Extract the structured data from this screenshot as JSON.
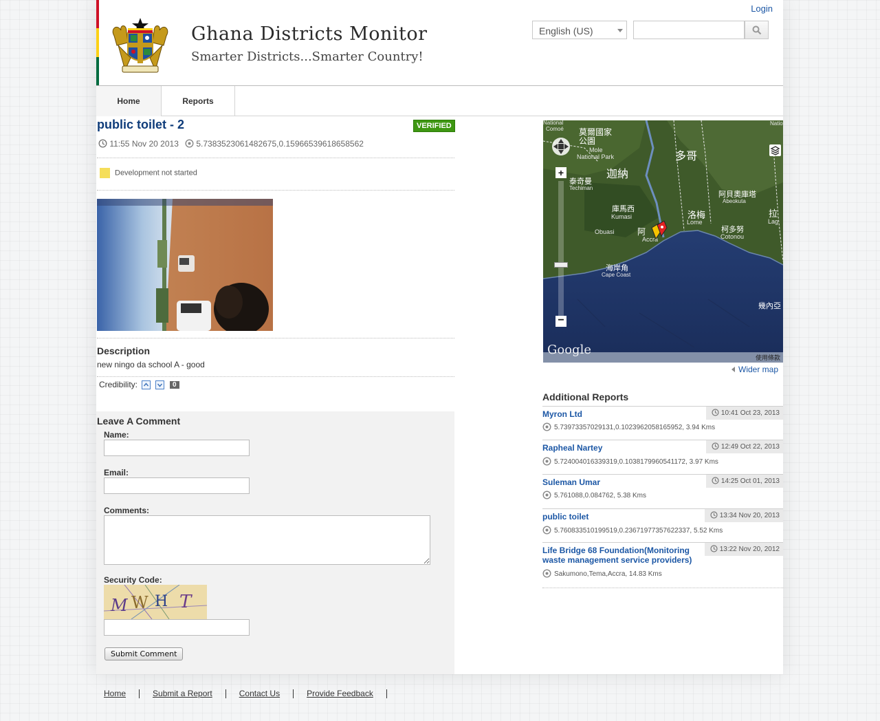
{
  "header": {
    "site_title": "Ghana Districts Monitor",
    "tagline": "Smarter Districts...Smarter Country!",
    "login_label": "Login",
    "language_selected": "English (US)",
    "search_placeholder": ""
  },
  "nav": {
    "items": [
      {
        "label": "Home"
      },
      {
        "label": "Reports"
      }
    ]
  },
  "report": {
    "title": "public toilet - 2",
    "verified_label": "VERIFIED",
    "datetime": "11:55 Nov 20 2013",
    "location": "5.7383523061482675,0.15966539618658562",
    "status": "Development not started",
    "description_heading": "Description",
    "description": "new ningo da school A - good",
    "credibility_label": "Credibility:",
    "credibility_count": "0"
  },
  "comment_form": {
    "heading": "Leave A Comment",
    "name_label": "Name:",
    "email_label": "Email:",
    "comments_label": "Comments:",
    "security_label": "Security Code:",
    "captcha_text": [
      "M",
      "W",
      "H",
      "T"
    ],
    "submit_label": "Submit Comment"
  },
  "map": {
    "places": {
      "mole_zh": "莫爾國家公園",
      "mole_en1": "Mole",
      "mole_en2": "National Park",
      "ghana_zh": "迦納",
      "togo_zh": "多哥",
      "techiman_zh": "泰奇曼",
      "techiman_en": "Techiman",
      "kumasi_zh": "庫馬西",
      "kumasi_en": "Kumasi",
      "obuasi": "Obuasi",
      "lome_zh": "洛梅",
      "lome_en": "Lome",
      "abeokuta_zh": "阿貝奧庫塔",
      "abeokuta_en": "Abeokuta",
      "lagos_zh": "拉",
      "lagos_en": "Lag",
      "cotonou_zh": "柯多努",
      "cotonou_en": "Cotonou",
      "accra_zh": "阿",
      "accra_en": "Accra",
      "capecoast_zh": "海岸角",
      "capecoast_en": "Cape Coast",
      "guinea_zh": "幾內亞",
      "edge_national1": "National",
      "edge_comoe": "Comoé",
      "edge_natio": "Natio"
    },
    "terms": "使用條款",
    "attribution": "Google"
  },
  "wider_map_label": "Wider map",
  "additional_reports": {
    "heading": "Additional Reports",
    "items": [
      {
        "title": "Myron Ltd",
        "time": "10:41 Oct 23, 2013",
        "location": "5.73973357029131,0.1023962058165952, 3.94 Kms"
      },
      {
        "title": "Rapheal Nartey",
        "time": "12:49 Oct 22, 2013",
        "location": "5.724004016339319,0.1038179960541172, 3.97 Kms"
      },
      {
        "title": "Suleman Umar",
        "time": "14:25 Oct 01, 2013",
        "location": "5.761088,0.084762, 5.38 Kms"
      },
      {
        "title": "public toilet",
        "time": "13:34 Nov 20, 2013",
        "location": "5.760833510199519,0.23671977357622337, 5.52 Kms"
      },
      {
        "title": "Life Bridge 68 Foundation(Monitoring waste management service providers)",
        "time": "13:22 Nov 20, 2012",
        "location": "Sakumono,Tema,Accra, 14.83 Kms"
      }
    ]
  },
  "footer": {
    "links": [
      {
        "label": "Home"
      },
      {
        "label": "Submit a Report"
      },
      {
        "label": "Contact Us"
      },
      {
        "label": "Provide Feedback"
      }
    ]
  },
  "colors": {
    "link": "#1c57a5",
    "title": "#0f3c7a",
    "verified": "#3e9712",
    "status_marker": "#f5de5a",
    "flag_red": "#ce1126",
    "flag_gold": "#fcd116",
    "flag_green": "#006b3f"
  },
  "icons": [
    "clock-icon",
    "location-icon",
    "search-icon",
    "caret-down-icon",
    "coat-of-arms-logo",
    "map-pan-control",
    "map-layers-icon",
    "map-marker-icon"
  ]
}
